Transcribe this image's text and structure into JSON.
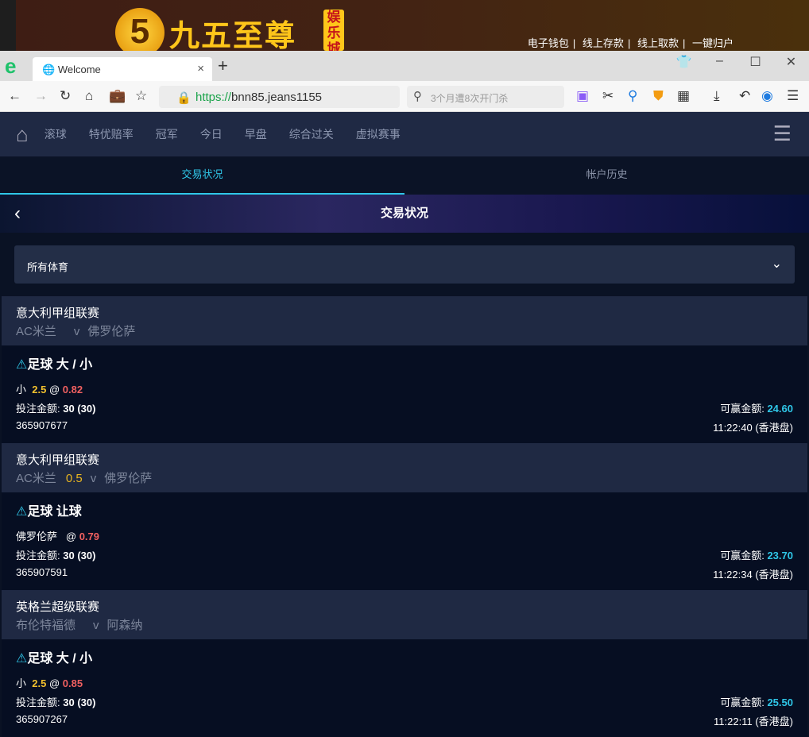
{
  "banner": {
    "logo_digit": "5",
    "logo_text": "九五至尊",
    "logo_tag": "娱乐城",
    "links": [
      "电子钱包",
      "线上存款",
      "线上取款",
      "一键归户"
    ]
  },
  "browser": {
    "tab_title": "Welcome",
    "url_scheme": "https://",
    "url_rest": "bnn85.jeans1155",
    "search_placeholder": "3个月遭8次开门杀"
  },
  "nav": {
    "items": [
      "滚球",
      "特优赔率",
      "冠军",
      "今日",
      "早盘",
      "综合过关",
      "虚拟赛事"
    ]
  },
  "subtabs": [
    "交易状况",
    "帐户历史"
  ],
  "header": {
    "title": "交易状况"
  },
  "filter": {
    "value": "所有体育"
  },
  "bets": [
    {
      "league": "意大利甲组联赛",
      "home": "AC米兰",
      "handicap": "",
      "away": "佛罗伦萨",
      "type": "足球 大 / 小",
      "selection": "小",
      "line": "2.5",
      "odds": "0.82",
      "stake_label": "投注金额:",
      "stake": "30 (30)",
      "win_label": "可赢金额:",
      "win": "24.60",
      "id": "365907677",
      "time": "11:22:40 (香港盘)"
    },
    {
      "league": "意大利甲组联赛",
      "home": "AC米兰",
      "handicap": "0.5",
      "away": "佛罗伦萨",
      "type": "足球 让球",
      "selection": "佛罗伦萨",
      "line": "",
      "odds": "0.79",
      "stake_label": "投注金额:",
      "stake": "30 (30)",
      "win_label": "可赢金额:",
      "win": "23.70",
      "id": "365907591",
      "time": "11:22:34 (香港盘)"
    },
    {
      "league": "英格兰超级联赛",
      "home": "布伦特福德",
      "handicap": "",
      "away": "阿森纳",
      "type": "足球 大 / 小",
      "selection": "小",
      "line": "2.5",
      "odds": "0.85",
      "stake_label": "投注金额:",
      "stake": "30 (30)",
      "win_label": "可赢金额:",
      "win": "25.50",
      "id": "365907267",
      "time": "11:22:11 (香港盘)"
    }
  ],
  "vs": "v",
  "at": "@"
}
